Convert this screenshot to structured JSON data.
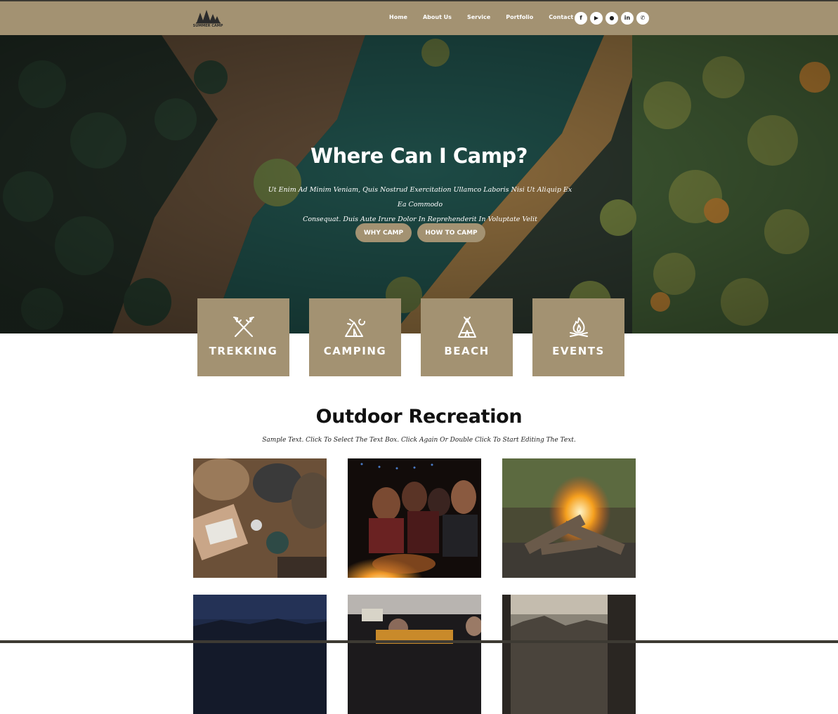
{
  "header": {
    "logo_text": "SUMMER CAMP",
    "nav": [
      "Home",
      "About Us",
      "Service",
      "Portfolio",
      "Contact"
    ],
    "social_icons": [
      "facebook-icon",
      "youtube-icon",
      "github-icon",
      "linkedin-icon",
      "whatsapp-icon"
    ],
    "social_glyphs": [
      "f",
      "▶",
      "●",
      "in",
      "✆"
    ]
  },
  "hero": {
    "title": "Where Can I Camp?",
    "subtitle_line1": "Ut Enim Ad Minim Veniam, Quis Nostrud Exercitation Ullamco Laboris Nisi Ut Aliquip Ex Ea Commodo",
    "subtitle_line2": "Consequat. Duis Aute Irure Dolor In Reprehenderit In Voluptate Velit",
    "buttons": [
      "WHY CAMP",
      "HOW TO CAMP"
    ]
  },
  "categories": [
    {
      "label": "TREKKING",
      "icon": "trekking-poles-icon"
    },
    {
      "label": "CAMPING",
      "icon": "camping-tent-icon"
    },
    {
      "label": "BEACH",
      "icon": "beach-tent-icon"
    },
    {
      "label": "EVENTS",
      "icon": "campfire-icon"
    }
  ],
  "section": {
    "title": "Outdoor Recreation",
    "subtitle": "Sample Text. Click To Select The Text Box. Click Again Or Double Click To Start Editing The Text."
  },
  "colors": {
    "brand": "#a39272",
    "dark": "#3d3a33",
    "text": "#111111",
    "white": "#ffffff"
  }
}
